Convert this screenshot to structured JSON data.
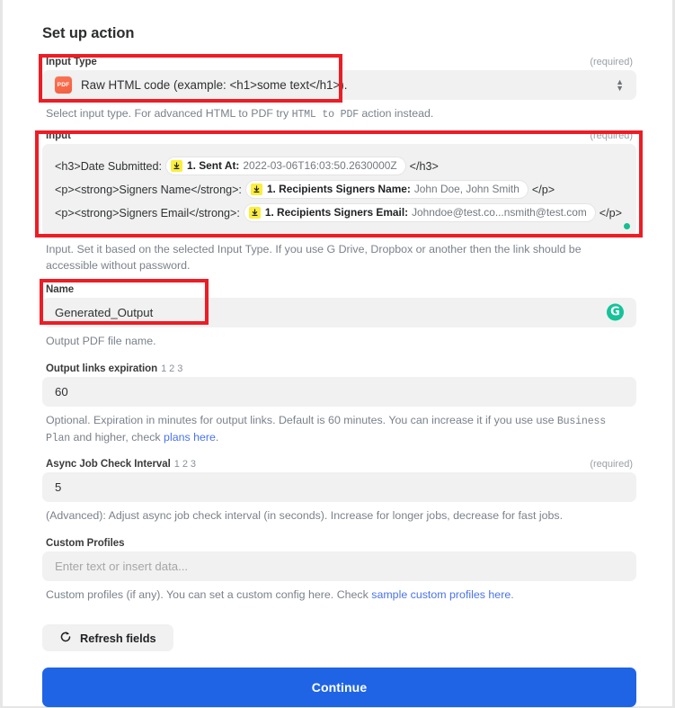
{
  "header": {
    "title": "Set up action"
  },
  "fields": {
    "input_type": {
      "label": "Input Type",
      "required_note": "(required)",
      "icon": "pdf-file-icon",
      "value": "Raw HTML code (example: <h1>some text</h1>).",
      "help_pre": "Select input type. For advanced HTML to PDF try ",
      "help_mono": "HTML  to  PDF",
      "help_post": " action instead."
    },
    "input": {
      "label": "Input",
      "required_note": "(required)",
      "lines": [
        {
          "prefix": "<h3>Date Submitted:",
          "token_label": "1. Sent At:",
          "token_value": "2022-03-06T16:03:50.2630000Z",
          "suffix": "</h3>"
        },
        {
          "prefix": "<p><strong>Signers Name</strong>:",
          "token_label": "1. Recipients Signers Name:",
          "token_value": "John Doe, John Smith",
          "suffix": "</p>"
        },
        {
          "prefix": "<p><strong>Signers Email</strong>:",
          "token_label": "1. Recipients Signers Email:",
          "token_value": "Johndoe@test.co...nsmith@test.com",
          "suffix": "</p>"
        }
      ],
      "help": "Input. Set it based on the selected Input  Type. If you use G Drive, Dropbox or another then the link should be accessible without password."
    },
    "name": {
      "label": "Name",
      "value": "Generated_Output",
      "help": "Output PDF file name.",
      "badge": "G"
    },
    "output_links_expiration": {
      "label": "Output links expiration",
      "sup": "1 2 3",
      "value": "60",
      "help_pre": "Optional. Expiration in minutes for output links. Default is 60 minutes. You can increase it if you use use ",
      "help_mono": "Business  Plan",
      "help_mid": " and higher, check ",
      "help_link": "plans here",
      "help_post": "."
    },
    "async_job_check_interval": {
      "label": "Async Job Check Interval",
      "sup": "1 2 3",
      "required_note": "(required)",
      "value": "5",
      "help": "(Advanced): Adjust async job check interval (in seconds). Increase for longer jobs, decrease for fast jobs."
    },
    "custom_profiles": {
      "label": "Custom Profiles",
      "value": "",
      "placeholder": "Enter text or insert data...",
      "help_pre": "Custom profiles (if any). You can set a custom config here. Check ",
      "help_link": "sample custom profiles here",
      "help_post": "."
    }
  },
  "actions": {
    "refresh_label": "Refresh fields",
    "continue_label": "Continue"
  },
  "colors": {
    "annotation": "#ee1c24",
    "primary_button": "#1f64e5",
    "link": "#4a74e8",
    "badge_green": "#15c39a",
    "token_icon": "#fbee3d",
    "pdf_icon": "#f3603f"
  }
}
